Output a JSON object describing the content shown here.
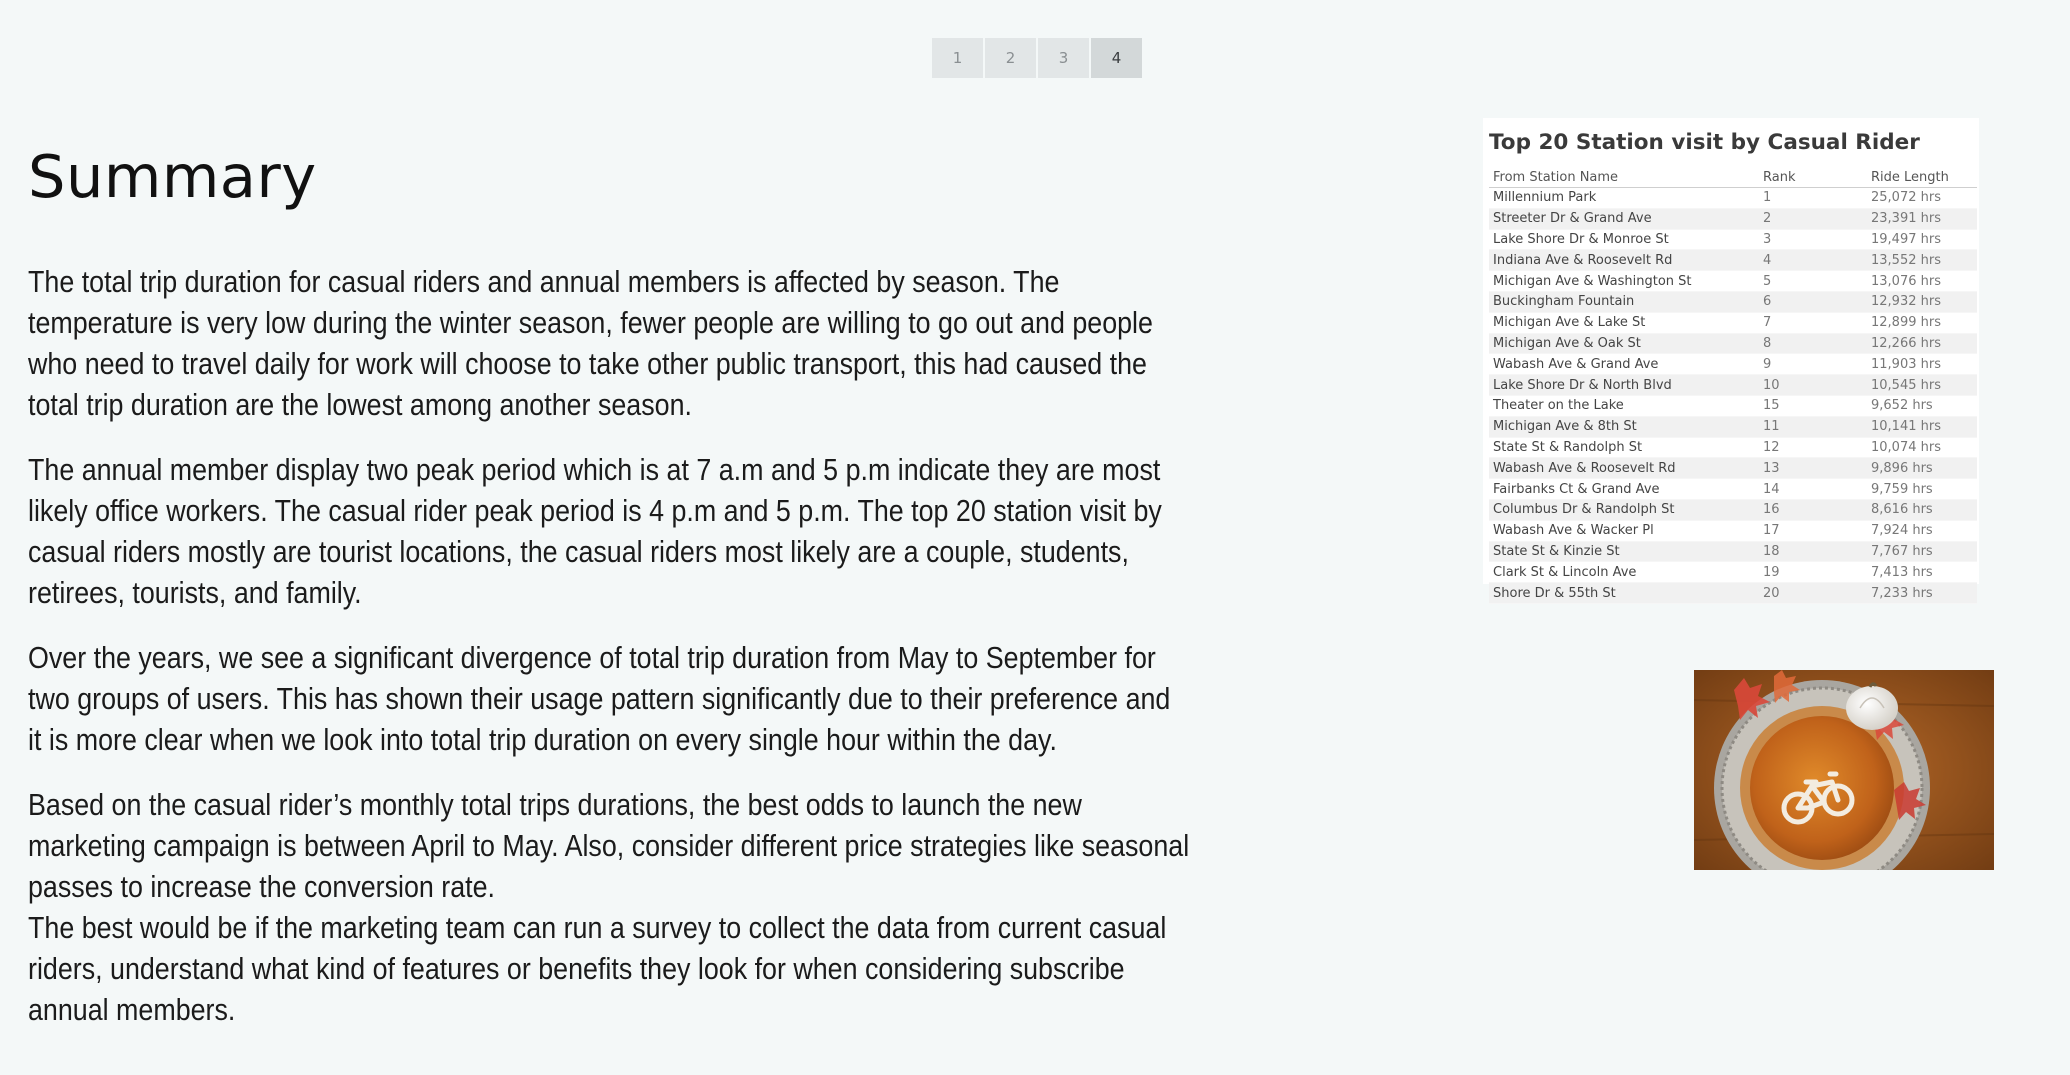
{
  "pager": {
    "pages": [
      "1",
      "2",
      "3",
      "4"
    ],
    "active": "4"
  },
  "summary": {
    "title": "Summary",
    "paragraphs": [
      "The total trip duration for casual riders and annual members is affected by season. The temperature is very low during the winter season, fewer people are willing to go out and people who need to travel daily for work will choose to take other public transport, this had caused the total trip duration are the lowest among another season.",
      "The annual member display two peak period which is at 7 a.m and 5 p.m indicate they are most likely office workers. The casual rider peak period is 4 p.m and 5 p.m. The top 20 station visit by casual riders mostly are tourist locations, the casual riders most likely are a couple, students, retirees, tourists, and family.",
      "Over the years, we see a significant divergence of total trip duration from May to September for two groups of users. This has shown their usage pattern significantly due to their preference and it is more clear when we look into total trip duration on every single hour within the day.",
      "Based on the casual rider’s monthly total trips durations, the best odds to launch the new marketing campaign is between April to May. Also, consider different price strategies like seasonal passes to increase the conversion rate.",
      "The best would be if the marketing team can run a survey to collect the data from current casual riders, understand what kind of features or benefits they look for when considering subscribe annual members."
    ]
  },
  "station_table": {
    "title": "Top 20 Station visit by Casual Rider",
    "headers": [
      "From Station Name",
      "Rank",
      "Ride Length"
    ],
    "rows": [
      [
        "Millennium Park",
        "1",
        "25,072 hrs"
      ],
      [
        "Streeter Dr & Grand Ave",
        "2",
        "23,391 hrs"
      ],
      [
        "Lake Shore Dr & Monroe St",
        "3",
        "19,497 hrs"
      ],
      [
        "Indiana Ave & Roosevelt Rd",
        "4",
        "13,552 hrs"
      ],
      [
        "Michigan Ave & Washington St",
        "5",
        "13,076 hrs"
      ],
      [
        "Buckingham Fountain",
        "6",
        "12,932 hrs"
      ],
      [
        "Michigan Ave & Lake St",
        "7",
        "12,899 hrs"
      ],
      [
        "Michigan Ave & Oak St",
        "8",
        "12,266 hrs"
      ],
      [
        "Wabash Ave & Grand Ave",
        "9",
        "11,903 hrs"
      ],
      [
        "Lake Shore Dr & North Blvd",
        "10",
        "10,545 hrs"
      ],
      [
        "Theater on the Lake",
        "15",
        "9,652 hrs"
      ],
      [
        "Michigan Ave & 8th St",
        "11",
        "10,141 hrs"
      ],
      [
        "State St & Randolph St",
        "12",
        "10,074 hrs"
      ],
      [
        "Wabash Ave & Roosevelt Rd",
        "13",
        "9,896 hrs"
      ],
      [
        "Fairbanks Ct & Grand Ave",
        "14",
        "9,759 hrs"
      ],
      [
        "Columbus Dr & Randolph St",
        "16",
        "8,616 hrs"
      ],
      [
        "Wabash Ave & Wacker Pl",
        "17",
        "7,924 hrs"
      ],
      [
        "State St & Kinzie St",
        "18",
        "7,767 hrs"
      ],
      [
        "Clark St & Lincoln Ave",
        "19",
        "7,413 hrs"
      ],
      [
        "Shore Dr & 55th St",
        "20",
        "7,233 hrs"
      ]
    ]
  },
  "image": {
    "icon": "pumpkin-pie-bicycle-image"
  }
}
